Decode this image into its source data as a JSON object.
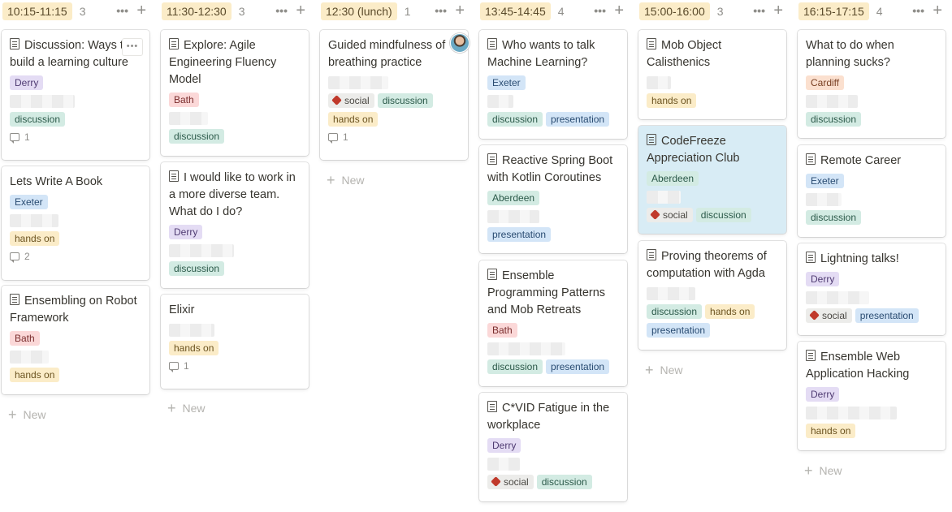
{
  "columns": [
    {
      "title": "10:15-11:15",
      "count": "3",
      "cards": [
        {
          "title": "Discussion: Ways to build a learning culture",
          "tags": [
            {
              "label": "Derry",
              "cls": "t-derry"
            }
          ],
          "tags2": [
            {
              "label": "discussion",
              "cls": "t-discussion"
            }
          ],
          "comments": "1"
        },
        {
          "title": "Lets Write A Book",
          "tags": [
            {
              "label": "Exeter",
              "cls": "t-exeter"
            }
          ],
          "tags2": [
            {
              "label": "hands on",
              "cls": "t-handson"
            }
          ],
          "comments": "2"
        },
        {
          "title": "Ensembling on Robot Framework",
          "tags": [
            {
              "label": "Bath",
              "cls": "t-bath"
            }
          ],
          "tags2": [
            {
              "label": "hands on",
              "cls": "t-handson"
            }
          ]
        }
      ]
    },
    {
      "title": "11:30-12:30",
      "count": "3",
      "cards": [
        {
          "title": "Explore: Agile Engineering Fluency Model",
          "tags": [
            {
              "label": "Bath",
              "cls": "t-bath"
            }
          ],
          "tags2": [
            {
              "label": "discussion",
              "cls": "t-discussion"
            }
          ]
        },
        {
          "title": "I would like to work in a more diverse team. What do I do?",
          "tags": [
            {
              "label": "Derry",
              "cls": "t-derry"
            }
          ],
          "tags2": [
            {
              "label": "discussion",
              "cls": "t-discussion"
            }
          ]
        },
        {
          "title": "Elixir",
          "tags2": [
            {
              "label": "hands on",
              "cls": "t-handson"
            }
          ],
          "comments": "1"
        }
      ]
    },
    {
      "title": "12:30 (lunch)",
      "count": "1",
      "cards": [
        {
          "title": "Guided mindfulness of breathing practice",
          "tags2": [
            {
              "label": "social",
              "cls": "t-social"
            },
            {
              "label": "discussion",
              "cls": "t-discussion"
            }
          ],
          "tags3": [
            {
              "label": "hands on",
              "cls": "t-handson"
            }
          ],
          "comments": "1"
        }
      ]
    },
    {
      "title": "13:45-14:45",
      "count": "4",
      "cards": [
        {
          "title": "Who wants to talk Machine Learning?",
          "tags": [
            {
              "label": "Exeter",
              "cls": "t-exeter"
            }
          ],
          "tags2": [
            {
              "label": "discussion",
              "cls": "t-discussion"
            },
            {
              "label": "presentation",
              "cls": "t-presentation"
            }
          ]
        },
        {
          "title": "Reactive Spring Boot with Kotlin Coroutines",
          "tags": [
            {
              "label": "Aberdeen",
              "cls": "t-aberdeen"
            }
          ],
          "tags2": [
            {
              "label": "presentation",
              "cls": "t-presentation"
            }
          ]
        },
        {
          "title": "Ensemble Programming Patterns and Mob Retreats",
          "tags": [
            {
              "label": "Bath",
              "cls": "t-bath"
            }
          ],
          "tags2": [
            {
              "label": "discussion",
              "cls": "t-discussion"
            },
            {
              "label": "presentation",
              "cls": "t-presentation"
            }
          ]
        },
        {
          "title": "C*VID Fatigue in the workplace",
          "tags": [
            {
              "label": "Derry",
              "cls": "t-derry"
            }
          ],
          "tags2": [
            {
              "label": "social",
              "cls": "t-social"
            },
            {
              "label": "discussion",
              "cls": "t-discussion"
            }
          ]
        }
      ]
    },
    {
      "title": "15:00-16:00",
      "count": "3",
      "cards": [
        {
          "title": "Mob Object Calisthenics",
          "tags2": [
            {
              "label": "hands on",
              "cls": "t-handson"
            }
          ]
        },
        {
          "title": "CodeFreeze Appreciation Club",
          "tags": [
            {
              "label": "Aberdeen",
              "cls": "t-aberdeen"
            }
          ],
          "tags2": [
            {
              "label": "social",
              "cls": "t-social"
            },
            {
              "label": "discussion",
              "cls": "t-discussion"
            }
          ]
        },
        {
          "title": "Proving theorems of computation with Agda",
          "tags2": [
            {
              "label": "discussion",
              "cls": "t-discussion"
            },
            {
              "label": "hands on",
              "cls": "t-handson"
            }
          ],
          "tags3": [
            {
              "label": "presentation",
              "cls": "t-presentation"
            }
          ]
        }
      ]
    },
    {
      "title": "16:15-17:15",
      "count": "4",
      "cards": [
        {
          "title": "What to do when planning sucks?",
          "tags": [
            {
              "label": "Cardiff",
              "cls": "t-cardiff"
            }
          ],
          "tags2": [
            {
              "label": "discussion",
              "cls": "t-discussion"
            }
          ]
        },
        {
          "title": "Remote Career",
          "tags": [
            {
              "label": "Exeter",
              "cls": "t-exeter"
            }
          ],
          "tags2": [
            {
              "label": "discussion",
              "cls": "t-discussion"
            }
          ]
        },
        {
          "title": "Lightning talks!",
          "tags": [
            {
              "label": "Derry",
              "cls": "t-derry"
            }
          ],
          "tags2": [
            {
              "label": "social",
              "cls": "t-social"
            },
            {
              "label": "presentation",
              "cls": "t-presentation"
            }
          ]
        },
        {
          "title": "Ensemble Web Application Hacking",
          "tags": [
            {
              "label": "Derry",
              "cls": "t-derry"
            }
          ],
          "tags2": [
            {
              "label": "hands on",
              "cls": "t-handson"
            }
          ]
        }
      ]
    }
  ],
  "new_label": "New",
  "column_more_label": "•••",
  "column_add_label": "+",
  "card_more_label": "•••",
  "icons": {
    "page": "page-icon",
    "comment": "comment-icon",
    "social": "social-die-icon",
    "plus": "plus-icon"
  }
}
